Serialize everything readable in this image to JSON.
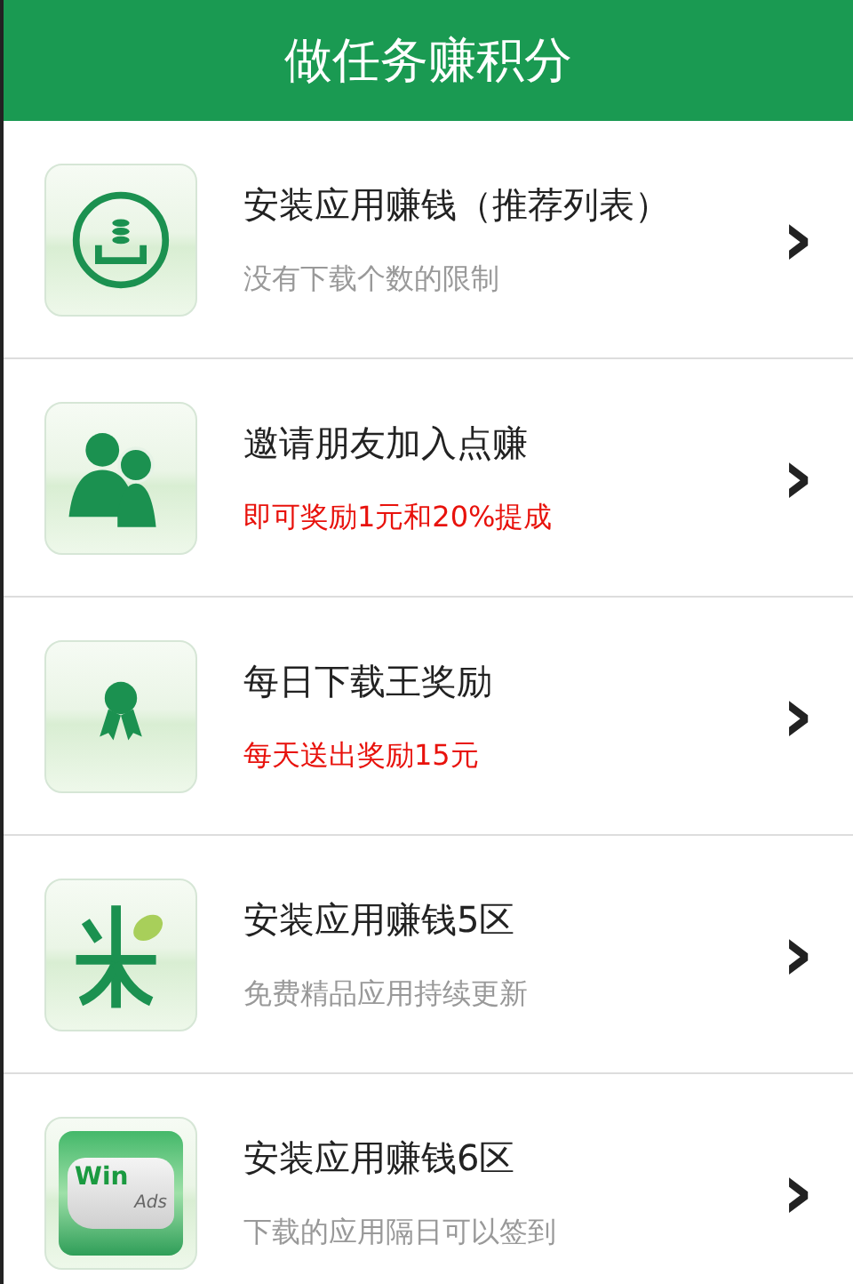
{
  "header": {
    "title": "做任务赚积分"
  },
  "tasks": [
    {
      "kind": "download",
      "title": "安装应用赚钱（推荐列表）",
      "subtitle": "没有下载个数的限制",
      "highlight": false,
      "arrow": "›"
    },
    {
      "kind": "friends",
      "title": "邀请朋友加入点赚",
      "subtitle": "即可奖励1元和20%提成",
      "highlight": true,
      "arrow": "›"
    },
    {
      "kind": "ribbon",
      "title": "每日下载王奖励",
      "subtitle": "每天送出奖励15元",
      "highlight": true,
      "arrow": "›"
    },
    {
      "kind": "rice",
      "title": "安装应用赚钱5区",
      "subtitle": "免费精品应用持续更新",
      "highlight": false,
      "arrow": "›"
    },
    {
      "kind": "winads",
      "icon_text": [
        "Win",
        "Ads"
      ],
      "title": "安装应用赚钱6区",
      "subtitle": "下载的应用隔日可以签到",
      "highlight": false,
      "arrow": "›"
    }
  ]
}
